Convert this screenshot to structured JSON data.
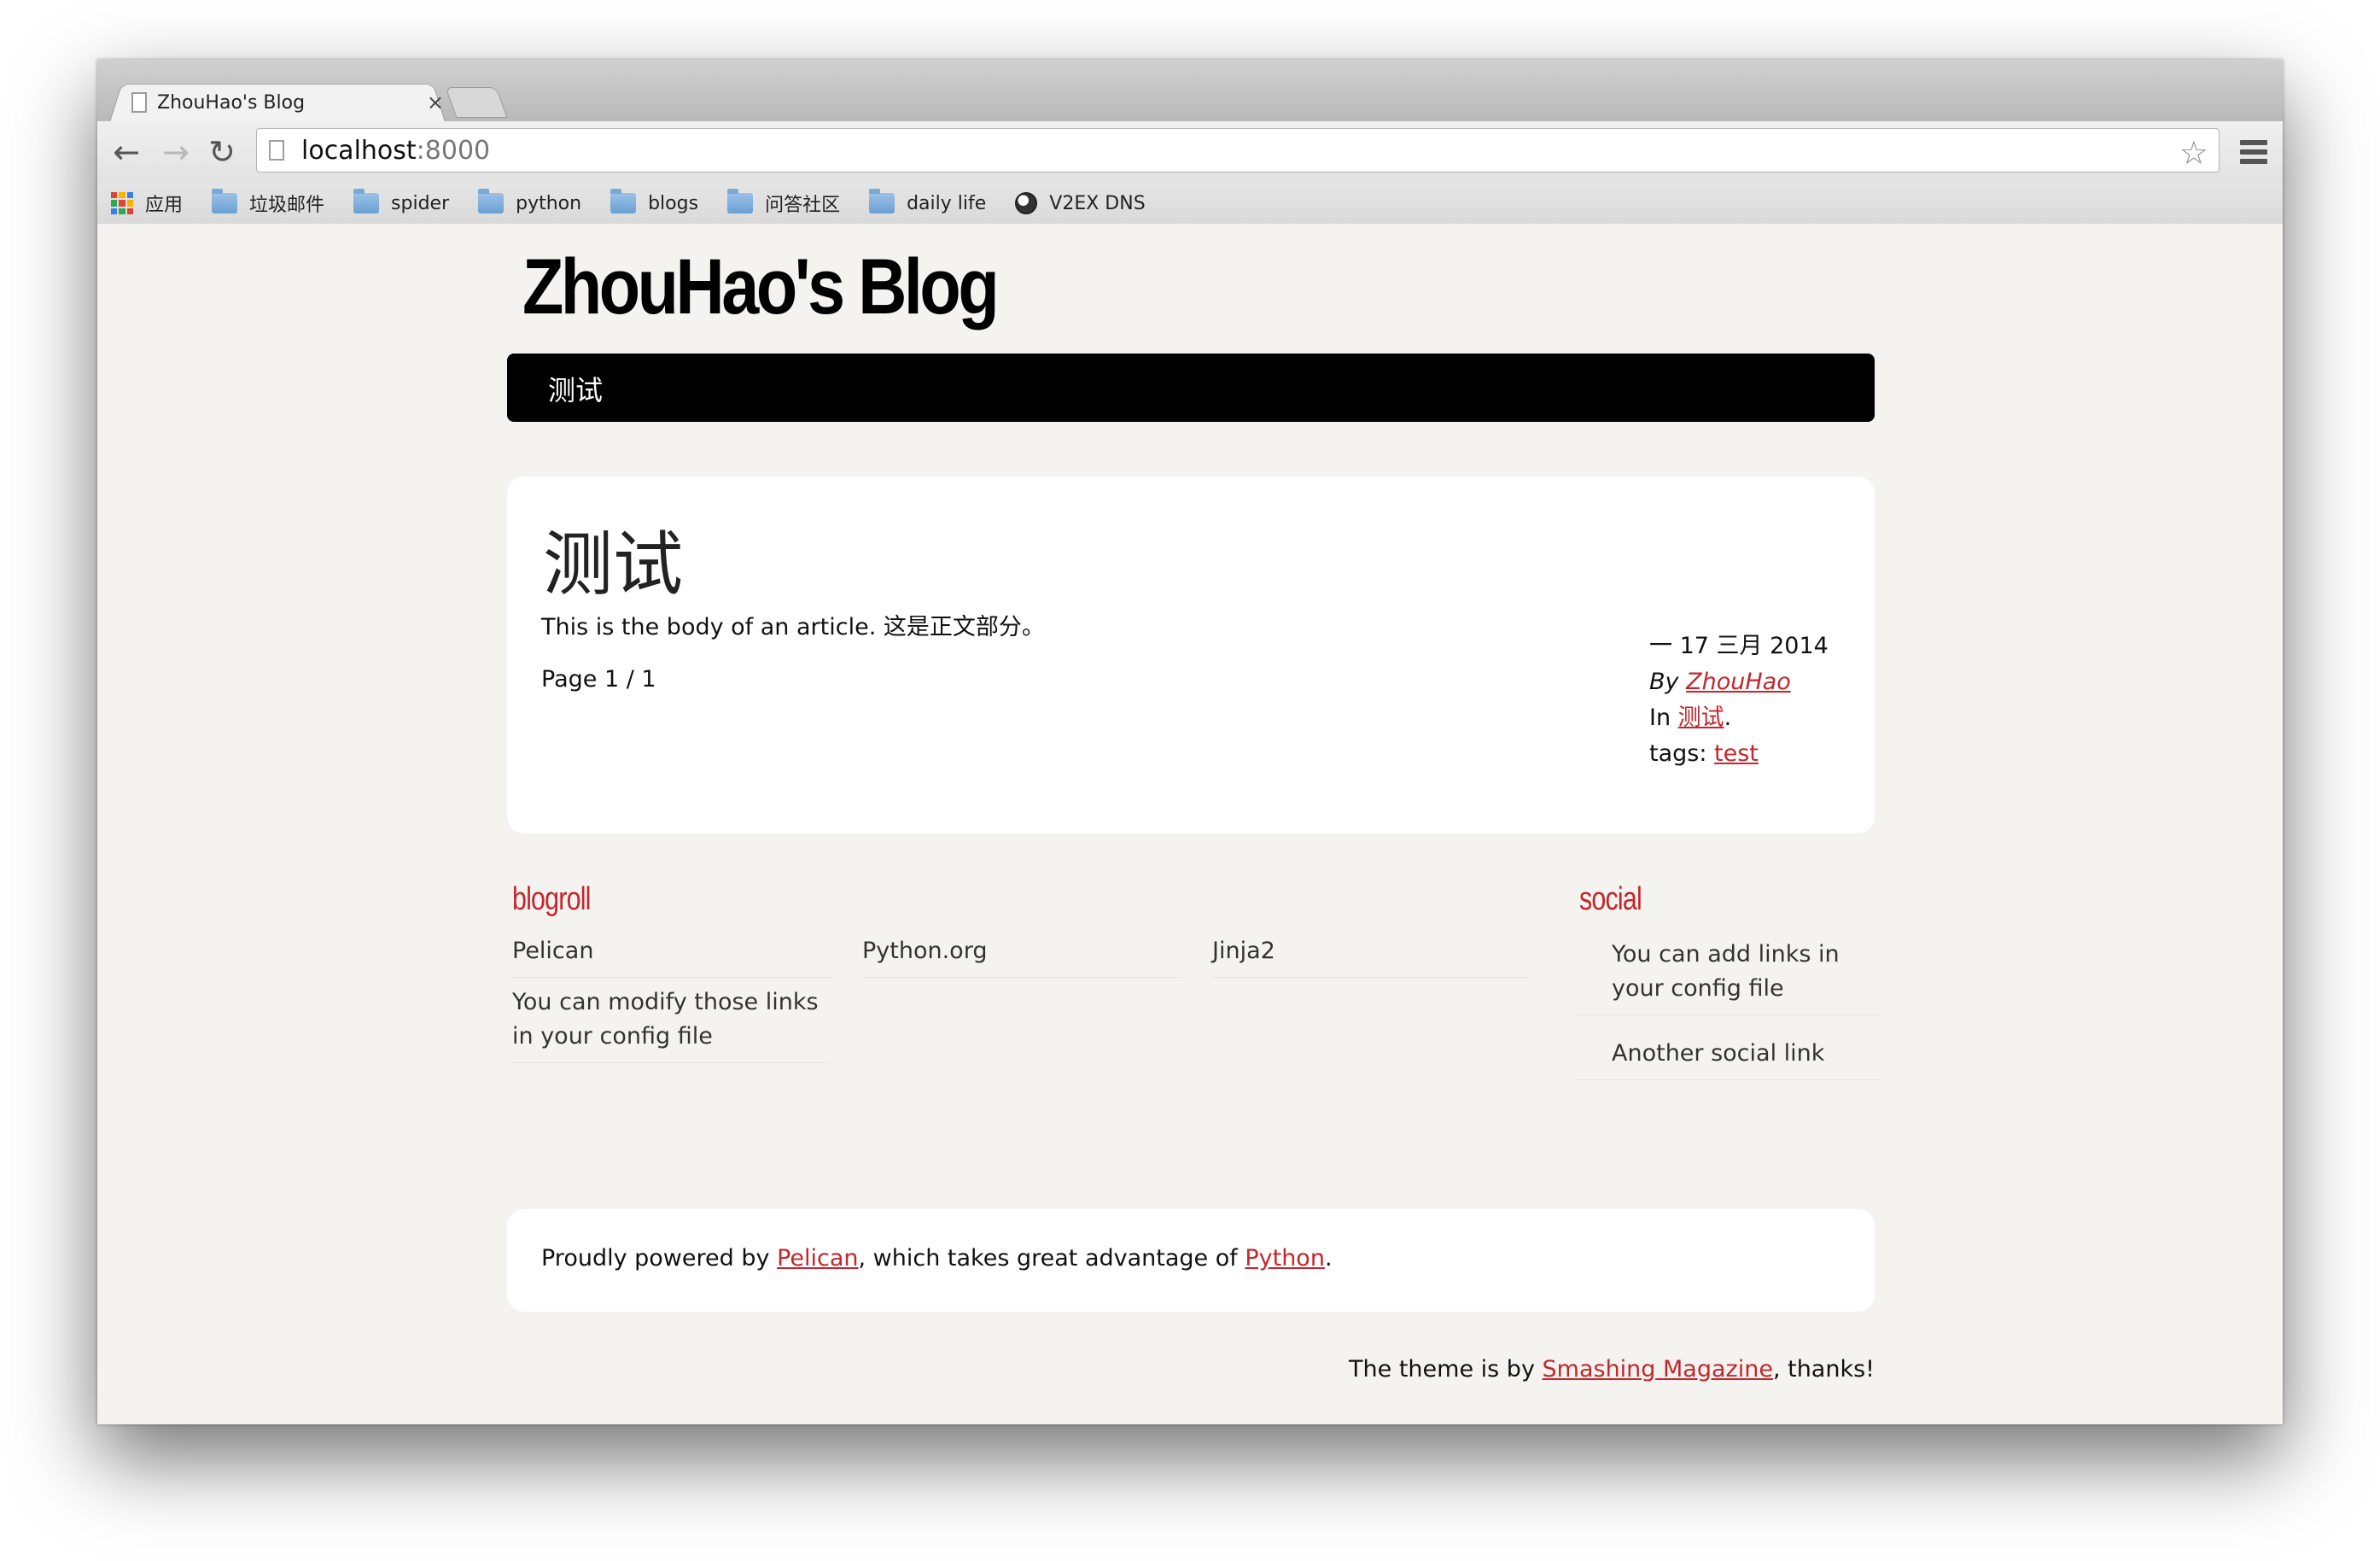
{
  "browser": {
    "tab_title": "ZhouHao's Blog",
    "tab_close": "×",
    "url_host": "localhost",
    "url_port": ":8000",
    "back": "←",
    "forward": "→",
    "reload": "↻",
    "star": "☆",
    "bookmarks": [
      {
        "label": "应用",
        "icon": "apps-icon"
      },
      {
        "label": "垃圾邮件",
        "icon": "folder-icon"
      },
      {
        "label": "spider",
        "icon": "folder-icon"
      },
      {
        "label": "python",
        "icon": "folder-icon"
      },
      {
        "label": "blogs",
        "icon": "folder-icon"
      },
      {
        "label": "问答社区",
        "icon": "folder-icon"
      },
      {
        "label": "daily life",
        "icon": "folder-icon"
      },
      {
        "label": "V2EX DNS",
        "icon": "v2ex-icon"
      }
    ]
  },
  "site": {
    "title": "ZhouHao's Blog",
    "nav": [
      "测试"
    ]
  },
  "article": {
    "title": "测试",
    "body": "This is the body of an article. 这是正文部分。",
    "pager": "Page 1 / 1",
    "date": "一 17 三月 2014",
    "by_label": "By",
    "author": "ZhouHao",
    "in_label": "In",
    "category": "测试",
    "category_suffix": ".",
    "tags_label": "tags:",
    "tag": "test"
  },
  "blogroll": {
    "heading": "blogroll",
    "links": [
      "Pelican",
      "Python.org",
      "Jinja2",
      "You can modify those links in your config file"
    ]
  },
  "social": {
    "heading": "social",
    "links": [
      "You can add links in your config file",
      "Another social link"
    ]
  },
  "footer": {
    "powered_prefix": "Proudly powered by",
    "pelican": "Pelican",
    "middle": ", which takes great advantage of",
    "python": "Python",
    "end": ".",
    "credits_prefix": "The theme is by",
    "smashing": "Smashing Magazine",
    "credits_suffix": ", thanks!"
  },
  "colors": {
    "accent": "#c2272d",
    "navbar": "#000000",
    "page_bg": "#f5f3ef"
  }
}
